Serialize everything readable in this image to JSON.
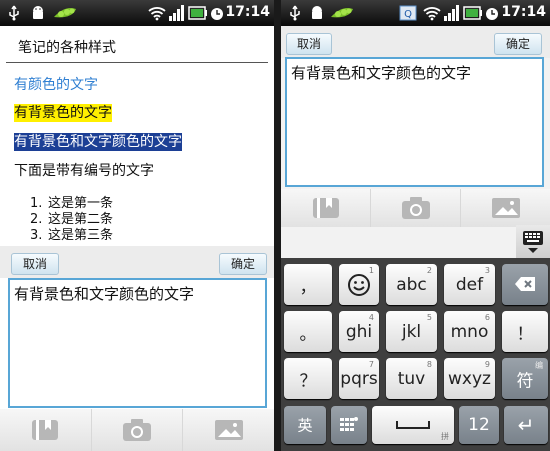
{
  "status": {
    "time": "17:14"
  },
  "left": {
    "note_title": "笔记的各种样式",
    "lines": {
      "colored": "有颜色的文字",
      "bg": "有背景色的文字",
      "bg_and_color": "有背景色和文字颜色的文字",
      "numbered_intro": "下面是带有编号的文字"
    },
    "list": [
      {
        "num": "1.",
        "text": "这是第一条"
      },
      {
        "num": "2.",
        "text": "这是第二条"
      },
      {
        "num": "3.",
        "text": "这是第三条"
      }
    ],
    "cancel_label": "取消",
    "ok_label": "确定",
    "input_text": "有背景色和文字颜色的文字"
  },
  "right": {
    "cancel_label": "取消",
    "ok_label": "确定",
    "input_text": "有背景色和文字颜色的文字"
  },
  "keyboard": {
    "row1": [
      {
        "main": "，",
        "sub": ""
      },
      {
        "main": "☺",
        "sub": "1"
      },
      {
        "main": "abc",
        "sub": "2"
      },
      {
        "main": "def",
        "sub": "3"
      },
      {
        "main": "⌫",
        "sub": ""
      }
    ],
    "row2": [
      {
        "main": "。",
        "sub": ""
      },
      {
        "main": "ghi",
        "sub": "4"
      },
      {
        "main": "jkl",
        "sub": "5"
      },
      {
        "main": "mno",
        "sub": "6"
      },
      {
        "main": "！",
        "sub": ""
      }
    ],
    "row3": [
      {
        "main": "？",
        "sub": ""
      },
      {
        "main": "pqrs",
        "sub": "7"
      },
      {
        "main": "tuv",
        "sub": "8"
      },
      {
        "main": "wxyz",
        "sub": "9"
      },
      {
        "main": "符",
        "sub": "编"
      }
    ],
    "row4": {
      "lang": "英",
      "layout_icon": "keypad-icon",
      "space_sub": "拼",
      "num": "12",
      "enter": "↵"
    }
  },
  "colors": {
    "blue_text": "#2f7fd2",
    "yellow_bg": "#fff000",
    "navy_bg": "#1c3f95",
    "accent": "#58a6d6"
  }
}
